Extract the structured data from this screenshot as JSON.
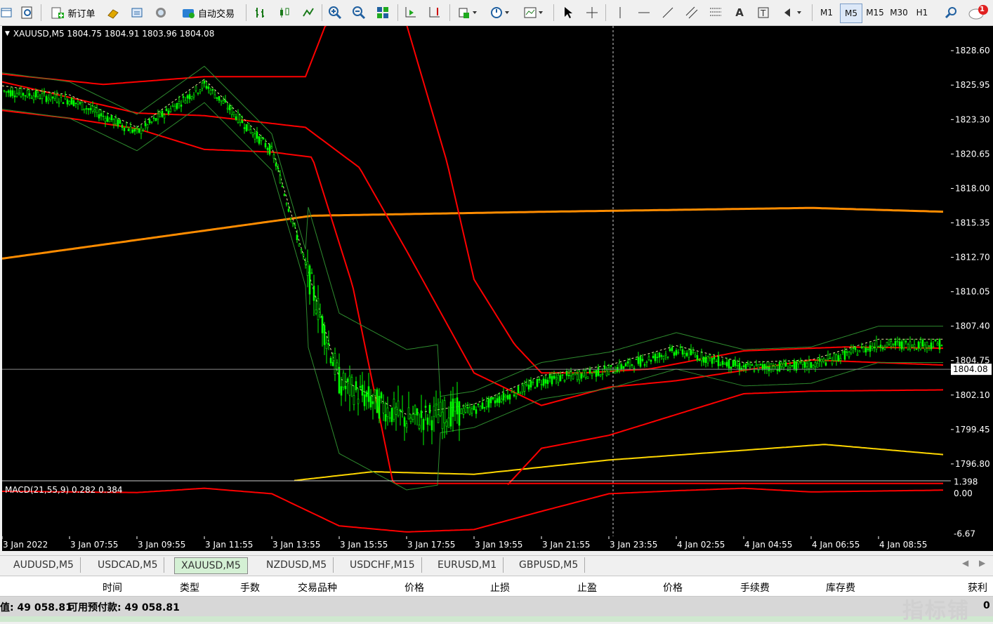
{
  "toolbar": {
    "new_order_label": "新订单",
    "auto_trading_label": "自动交易",
    "timeframes": [
      "M1",
      "M5",
      "M15",
      "M30",
      "H1"
    ],
    "active_timeframe": "M5",
    "notification_count": "1"
  },
  "chart": {
    "header": "XAUUSD,M5  1804.75 1804.91 1803.96 1804.08",
    "macd_label": "MACD(21,55,9) 0.282 0.384",
    "current_price": "1804.08",
    "price_ticks": [
      "1828.60",
      "1825.95",
      "1823.30",
      "1820.65",
      "1818.00",
      "1815.35",
      "1812.70",
      "1810.05",
      "1807.40",
      "1804.75",
      "1802.10",
      "1799.45",
      "1796.80"
    ],
    "macd_ticks": [
      "1.398",
      "0.00",
      "-6.67"
    ],
    "time_ticks": [
      "3 Jan 2022",
      "3 Jan 07:55",
      "3 Jan 09:55",
      "3 Jan 11:55",
      "3 Jan 13:55",
      "3 Jan 15:55",
      "3 Jan 17:55",
      "3 Jan 19:55",
      "3 Jan 21:55",
      "3 Jan 23:55",
      "4 Jan 02:55",
      "4 Jan 04:55",
      "4 Jan 06:55",
      "4 Jan 08:55"
    ],
    "colors": {
      "background": "#000000",
      "candle": "#00ff00",
      "band_red": "#ff0000",
      "ma_orange": "#ff8c00",
      "ma_yellow": "#ffd700",
      "band_green": "#2e8b2e"
    }
  },
  "chart_data": {
    "type": "line",
    "title": "XAUUSD,M5",
    "ylim": [
      1795.5,
      1830.5
    ],
    "x": [
      "3 Jan 2022",
      "3 Jan 07:55",
      "3 Jan 09:55",
      "3 Jan 11:55",
      "3 Jan 13:55",
      "3 Jan 15:55",
      "3 Jan 17:55",
      "3 Jan 19:55",
      "3 Jan 21:55",
      "3 Jan 23:55",
      "4 Jan 02:55",
      "4 Jan 04:55",
      "4 Jan 06:55",
      "4 Jan 08:55"
    ],
    "series": [
      {
        "name": "XAUUSD,M5",
        "values": [
          1825.5,
          1824.8,
          1822.3,
          1826.0,
          1820.8,
          1803.0,
          1800.2,
          1801.0,
          1803.2,
          1804.0,
          1805.5,
          1804.2,
          1804.4,
          1806.0
        ]
      }
    ],
    "grid": false
  },
  "tabs": [
    "AUDUSD,M5",
    "USDCAD,M5",
    "XAUUSD,M5",
    "NZDUSD,M5",
    "USDCHF,M15",
    "EURUSD,M1",
    "GBPUSD,M5"
  ],
  "active_tab": "XAUUSD,M5",
  "columns": [
    "时间",
    "类型",
    "手数",
    "交易品种",
    "价格",
    "止损",
    "止盈",
    "价格",
    "手续费",
    "库存费",
    "获利"
  ],
  "status": {
    "balance": "值: 49 058.81",
    "free_margin": "可用预付款: 49 058.81",
    "right_value": "0"
  },
  "watermark": "指标铺"
}
